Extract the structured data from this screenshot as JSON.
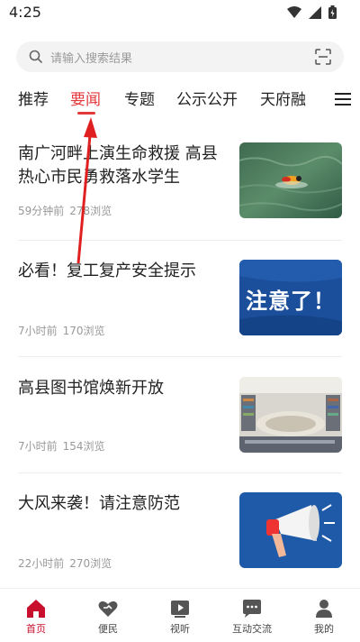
{
  "status": {
    "time": "4:25"
  },
  "search": {
    "placeholder": "请输入搜索结果"
  },
  "tabs": [
    {
      "label": "推荐",
      "active": false
    },
    {
      "label": "要闻",
      "active": true
    },
    {
      "label": "专题",
      "active": false
    },
    {
      "label": "公示公开",
      "active": false
    },
    {
      "label": "天府融",
      "active": false
    }
  ],
  "news": [
    {
      "title": "南广河畔上演生命救援 高县热心市民勇救落水学生",
      "time": "59分钟前",
      "views": "278浏览",
      "thumb": "river-rescue-photo"
    },
    {
      "title": "必看！复工复产安全提示",
      "time": "7小时前",
      "views": "170浏览",
      "thumb": "notice-banner",
      "thumb_text": "注意了！"
    },
    {
      "title": "高县图书馆焕新开放",
      "time": "7小时前",
      "views": "154浏览",
      "thumb": "library-photo"
    },
    {
      "title": "大风来袭！请注意防范",
      "time": "22小时前",
      "views": "270浏览",
      "thumb": "megaphone-illustration"
    }
  ],
  "bottom_nav": [
    {
      "label": "首页",
      "icon": "home-icon",
      "active": true
    },
    {
      "label": "便民",
      "icon": "heart-hand-icon",
      "active": false
    },
    {
      "label": "视听",
      "icon": "video-play-icon",
      "active": false
    },
    {
      "label": "互动交流",
      "icon": "chat-bubble-icon",
      "active": false
    },
    {
      "label": "我的",
      "icon": "person-icon",
      "active": false
    }
  ],
  "colors": {
    "accent": "#e4393c",
    "nav_active": "#c8102e",
    "arrow": "#e02020"
  }
}
